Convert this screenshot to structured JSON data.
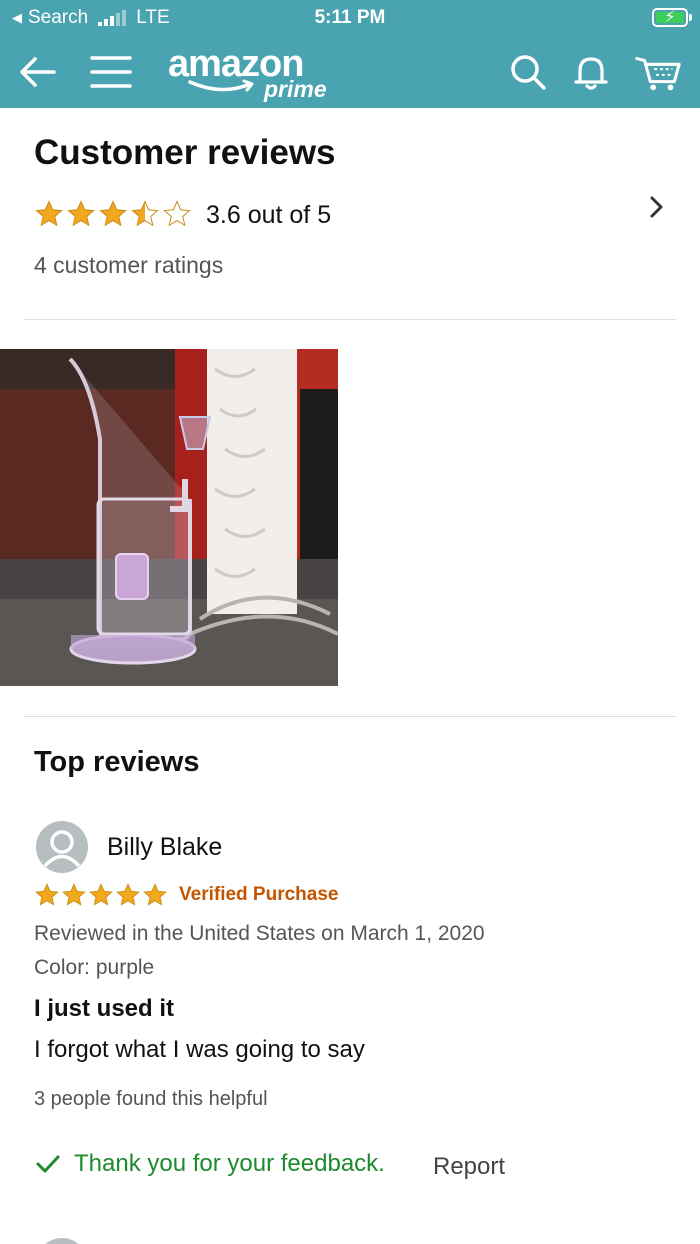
{
  "status_bar": {
    "back_app": "Search",
    "carrier": "LTE",
    "time": "5:11 PM",
    "battery_icon": "battery-charging-icon"
  },
  "nav": {
    "logo_text": "amazon",
    "logo_sub": "prime",
    "icons": [
      "back-arrow-icon",
      "menu-icon",
      "search-icon",
      "bell-icon",
      "cart-icon"
    ],
    "color": "#4aa3b0"
  },
  "customer_reviews": {
    "title": "Customer reviews",
    "rating": 3.6,
    "rating_text": "3.6 out of 5",
    "ratings_count": "4 customer ratings",
    "star_color": "#f0a81c"
  },
  "top_reviews": {
    "title": "Top reviews",
    "reviews": [
      {
        "reviewer": "Billy Blake",
        "stars": 5,
        "verified": "Verified Purchase",
        "reviewed_in": "Reviewed in the United States on March 1, 2020",
        "variant": "Color: purple",
        "title": "I just used it",
        "body": "I forgot what I was going to say",
        "helpful": "3 people found this helpful",
        "feedback": "Thank you for your feedback.",
        "report": "Report"
      }
    ]
  }
}
